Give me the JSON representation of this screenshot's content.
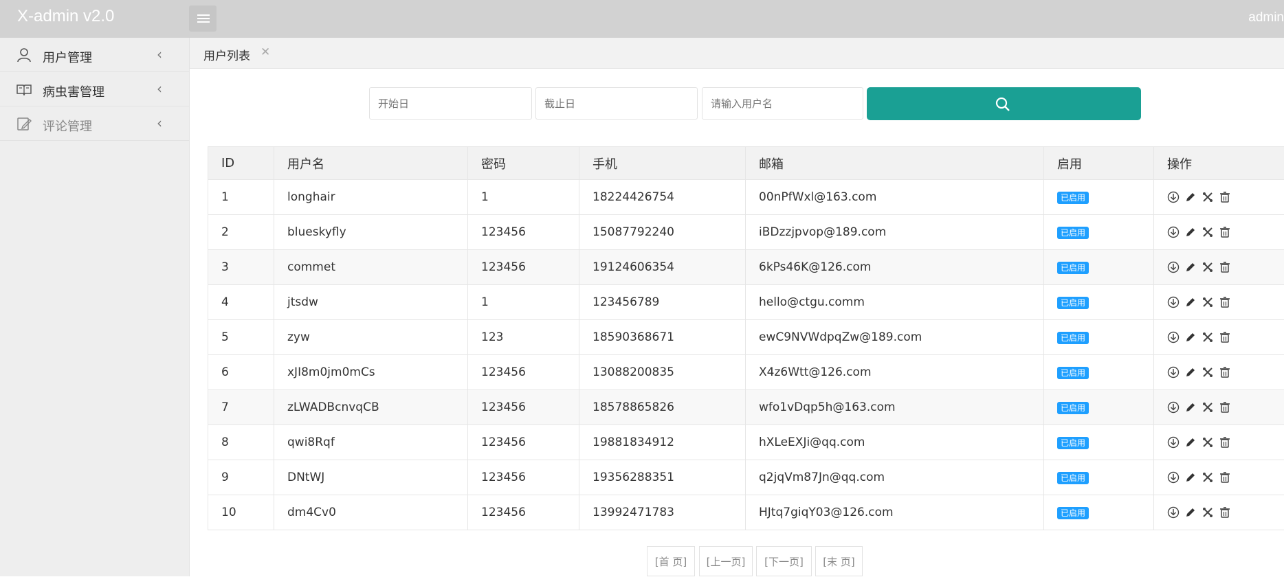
{
  "header": {
    "logo": "X-admin v2.0",
    "user": "admin"
  },
  "sidebar": {
    "items": [
      {
        "label": "用户管理",
        "icon": "user-icon"
      },
      {
        "label": "病虫害管理",
        "icon": "book-icon"
      },
      {
        "label": "评论管理",
        "icon": "edit-icon"
      }
    ]
  },
  "tabs": [
    {
      "label": "用户列表"
    }
  ],
  "search": {
    "start_placeholder": "开始日",
    "end_placeholder": "截止日",
    "username_placeholder": "请输入用户名",
    "button_icon": "search-icon"
  },
  "table": {
    "headers": [
      "ID",
      "用户名",
      "密码",
      "手机",
      "邮箱",
      "启用",
      "操作"
    ],
    "rows": [
      {
        "id": "1",
        "username": "longhair",
        "password": "1",
        "phone": "18224426754",
        "email": "00nPfWxl@163.com",
        "status": "已启用"
      },
      {
        "id": "2",
        "username": "blueskyfly",
        "password": "123456",
        "phone": "15087792240",
        "email": "iBDzzjpvop@189.com",
        "status": "已启用"
      },
      {
        "id": "3",
        "username": "commet",
        "password": "123456",
        "phone": "19124606354",
        "email": "6kPs46K@126.com",
        "status": "已启用"
      },
      {
        "id": "4",
        "username": "jtsdw",
        "password": "1",
        "phone": "123456789",
        "email": "hello@ctgu.comm",
        "status": "已启用"
      },
      {
        "id": "5",
        "username": "zyw",
        "password": "123",
        "phone": "18590368671",
        "email": "ewC9NVWdpqZw@189.com",
        "status": "已启用"
      },
      {
        "id": "6",
        "username": "xJI8m0jm0mCs",
        "password": "123456",
        "phone": "13088200835",
        "email": "X4z6Wtt@126.com",
        "status": "已启用"
      },
      {
        "id": "7",
        "username": "zLWADBcnvqCB",
        "password": "123456",
        "phone": "18578865826",
        "email": "wfo1vDqp5h@163.com",
        "status": "已启用"
      },
      {
        "id": "8",
        "username": "qwi8Rqf",
        "password": "123456",
        "phone": "19881834912",
        "email": "hXLeEXJi@qq.com",
        "status": "已启用"
      },
      {
        "id": "9",
        "username": "DNtWJ",
        "password": "123456",
        "phone": "19356288351",
        "email": "q2jqVm87Jn@qq.com",
        "status": "已启用"
      },
      {
        "id": "10",
        "username": "dm4Cv0",
        "password": "123456",
        "phone": "13992471783",
        "email": "HJtq7giqY03@126.com",
        "status": "已启用"
      }
    ],
    "op_icons": [
      "download-icon",
      "pencil-icon",
      "tools-icon",
      "trash-icon"
    ]
  },
  "pagination": {
    "first": "[首 页]",
    "prev": "[上一页]",
    "next": "[下一页]",
    "last": "[末 页]"
  },
  "colors": {
    "topbar": "#d2d2d2",
    "accent": "#1aa094",
    "badge": "#1e9fff",
    "sidebar": "#eeeeee"
  }
}
